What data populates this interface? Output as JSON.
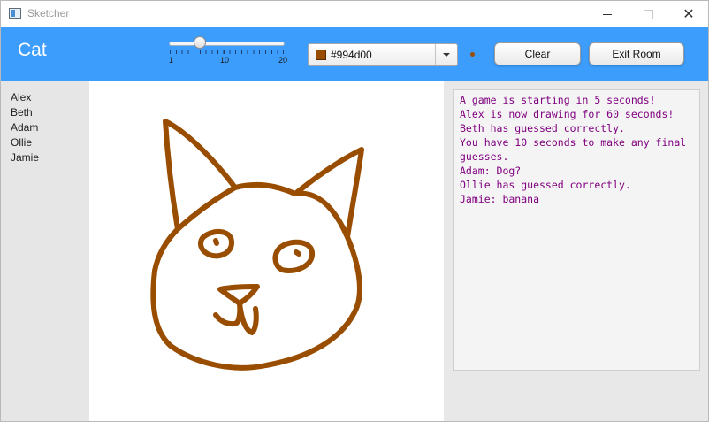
{
  "window": {
    "title": "Sketcher",
    "close_symbol": "✕"
  },
  "header": {
    "word": "Cat",
    "brush_size": {
      "value": 3,
      "min": 1,
      "max": 20,
      "tick_labels": [
        "1",
        "10",
        "20"
      ]
    },
    "color_picker": {
      "value": "#994d00",
      "swatch_color": "#994d00"
    },
    "clear_label": "Clear",
    "exit_label": "Exit Room",
    "accent_color": "#3d9dfc"
  },
  "players": [
    "Alex",
    "Beth",
    "Adam",
    "Ollie",
    "Jamie"
  ],
  "chat": [
    "A game is starting in 5 seconds!",
    "Alex is now drawing for 60 seconds!",
    "Beth has guessed correctly.",
    "You have 10 seconds to make any final guesses.",
    "Adam: Dog?",
    "Ollie has guessed correctly.",
    "Jamie: banana"
  ],
  "chat_color": "#800080"
}
